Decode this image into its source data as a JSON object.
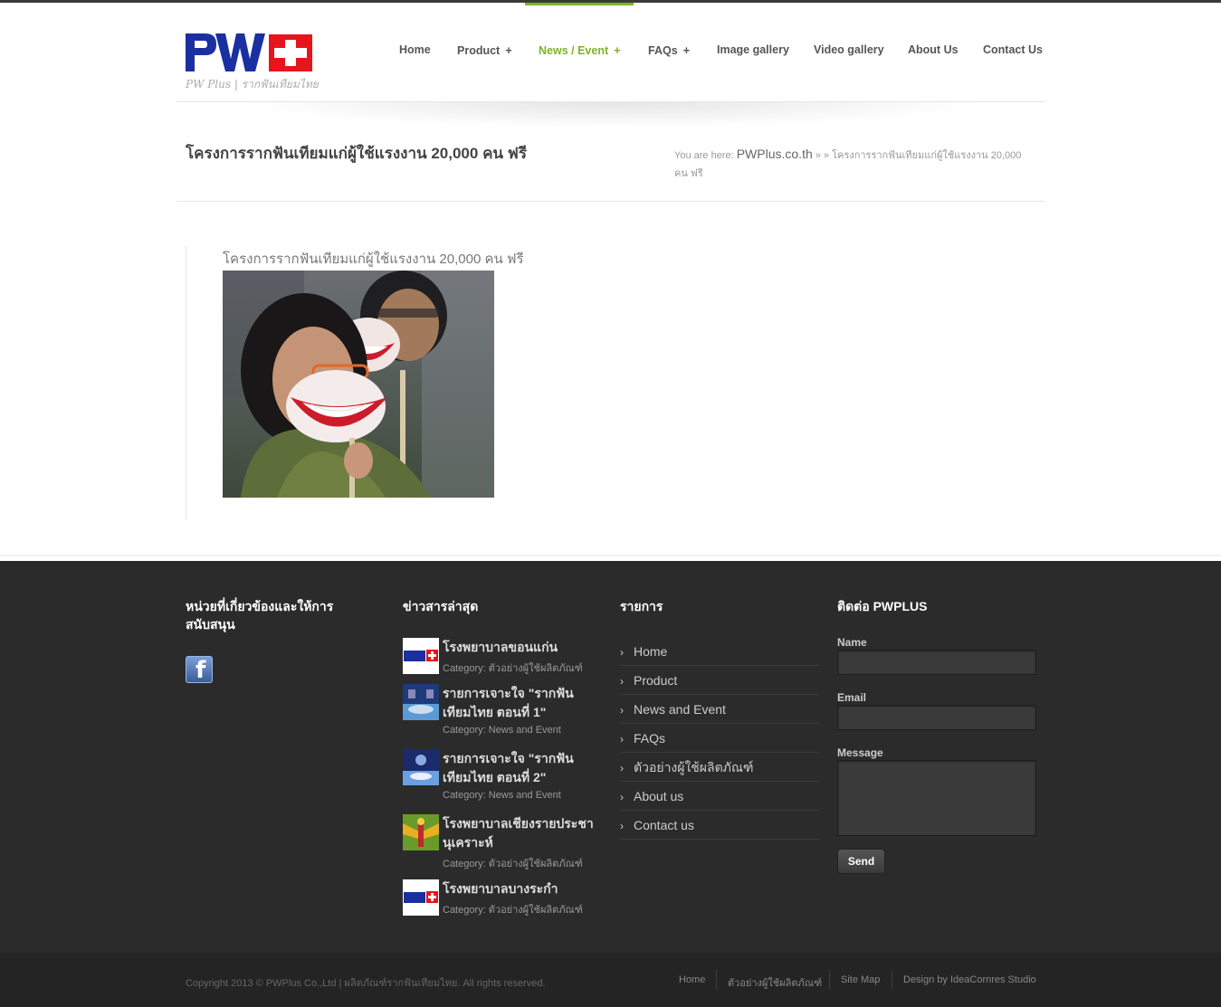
{
  "header": {
    "tagline": "PW Plus | รากฟันเทียมไทย",
    "nav": [
      {
        "label": "Home",
        "plus": ""
      },
      {
        "label": "Product",
        "plus": "+"
      },
      {
        "label": "News / Event",
        "plus": "+"
      },
      {
        "label": "FAQs",
        "plus": "+"
      },
      {
        "label": "Image gallery",
        "plus": ""
      },
      {
        "label": "Video gallery",
        "plus": ""
      },
      {
        "label": "About Us",
        "plus": ""
      },
      {
        "label": "Contact Us",
        "plus": ""
      }
    ],
    "active_index": 2
  },
  "page": {
    "title": "โครงการรากฟันเทียมแก่ผู้ใช้แรงงาน 20,000 คน ฟรี",
    "breadcrumb": {
      "prefix": "You are here:",
      "site": "PWPlus.co.th",
      "sep": "» »",
      "current": "โครงการรากฟันเทียมแก่ผู้ใช้แรงงาน 20,000 คน ฟรี"
    }
  },
  "post": {
    "heading": "โครงการรากฟันเทียมแก่ผู้ใช้แรงงาน 20,000 คน ฟรี"
  },
  "footer": {
    "col1": {
      "heading": "หน่วยที่เกี่ยวข้องและให้การสนับสนุน"
    },
    "col2": {
      "heading": "ข่าวสารล่าสุด",
      "items": [
        {
          "title": "โรงพยาบาลขอนแก่น",
          "category": "Category: ตัวอย่างผู้ใช้ผลิตภัณฑ์"
        },
        {
          "title": "รายการเจาะใจ \"รากฟันเทียมไทย ตอนที่ 1\"",
          "category": "Category: News and Event"
        },
        {
          "title": "รายการเจาะใจ \"รากฟันเทียมไทย ตอนที่ 2\"",
          "category": "Category: News and Event"
        },
        {
          "title": "โรงพยาบาลเชียงรายประชานุเคราะห์",
          "category": "Category: ตัวอย่างผู้ใช้ผลิตภัณฑ์"
        },
        {
          "title": "โรงพยาบาลบางระกำ",
          "category": "Category: ตัวอย่างผู้ใช้ผลิตภัณฑ์"
        }
      ]
    },
    "col3": {
      "heading": "รายการ",
      "items": [
        "Home",
        "Product",
        "News and Event",
        "FAQs",
        "ตัวอย่างผู้ใช้ผลิตภัณฑ์",
        "About us",
        "Contact us"
      ]
    },
    "col4": {
      "heading": "ติดต่อ PWPLUS",
      "name_label": "Name",
      "email_label": "Email",
      "message_label": "Message",
      "send_label": "Send"
    },
    "copyright": "Copyright 2013 © PWPlus Co.,Ltd | ผลิตภัณฑ์รากฟันเทียมไทย. All rights reserved.",
    "bottom_links": [
      "Home",
      "ตัวอย่างผู้ใช้ผลิตภัณฑ์",
      "Site Map",
      "Design by IdeaCornres Studio"
    ]
  },
  "colors": {
    "accent": "#7cb32a",
    "footer_bg": "#2b2b2b",
    "logo_blue": "#1a2fa0",
    "logo_red": "#e8141c"
  }
}
